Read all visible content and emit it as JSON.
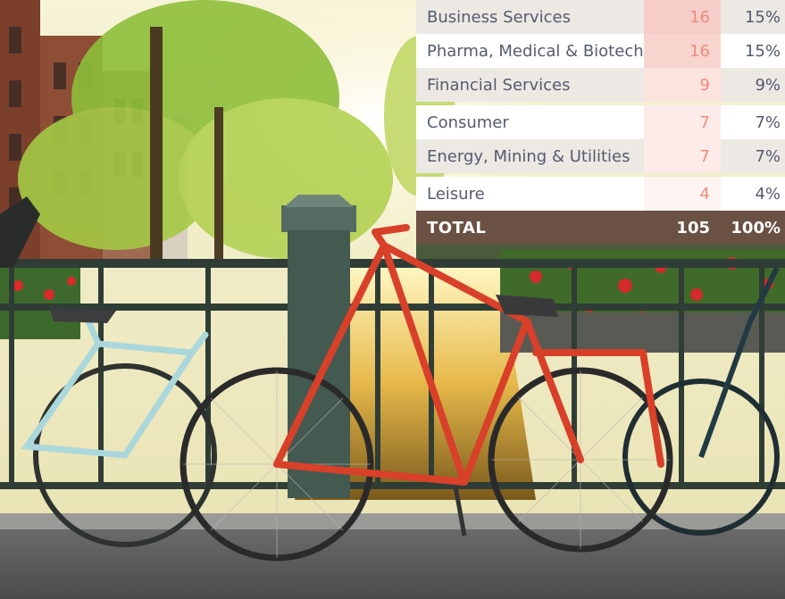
{
  "table": {
    "rows": [
      {
        "label": "Business Services",
        "count": "16",
        "percent": "15%",
        "heat": "#f6cdc8"
      },
      {
        "label": "Pharma, Medical & Biotech",
        "count": "16",
        "percent": "15%",
        "heat": "#f8d4ce"
      },
      {
        "label": "Financial Services",
        "count": "9",
        "percent": "9%",
        "heat": "#fbe3de"
      },
      {
        "label": "Consumer",
        "count": "7",
        "percent": "7%",
        "heat": "#fcebe8"
      },
      {
        "label": "Energy, Mining & Utilities",
        "count": "7",
        "percent": "7%",
        "heat": "#fcebe8"
      },
      {
        "label": "Leisure",
        "count": "4",
        "percent": "4%",
        "heat": "#fdf3f1"
      }
    ],
    "total": {
      "label": "TOTAL",
      "count": "105",
      "percent": "100%"
    },
    "count_text_color": "#ef8b7e",
    "total_bg": "#6b5143"
  }
}
